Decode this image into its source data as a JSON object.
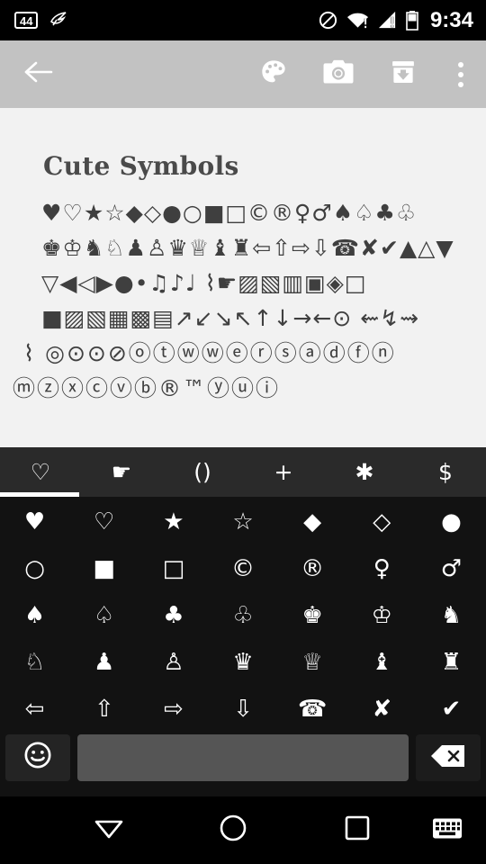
{
  "status_bar": {
    "badge_count": "44",
    "bird_icon": "bird-icon",
    "dnd_icon": "do-not-disturb-icon",
    "wifi_icon": "wifi-warning-icon",
    "cellular_icon": "cellular-warning-icon",
    "battery_icon": "battery-icon",
    "time": "9:34"
  },
  "toolbar": {
    "back_icon": "back-arrow-icon",
    "palette_icon": "palette-icon",
    "camera_icon": "camera-icon",
    "archive_icon": "archive-download-icon",
    "overflow_icon": "overflow-menu-icon"
  },
  "content": {
    "title": "Cute Symbols",
    "symbol_rows": [
      "♥♡★☆◆◇●○■□©®♀♂♠♤♣♧",
      "♚♔♞♘♟♙♛♕♝♜⇦⇧⇨⇩☎✘✔▲△▼",
      "▽◀◁▶●•♫♪♩ ⌇☛▨▧▥▣◈□",
      "■▨▧▦▩▤↗↙↘↖↑↓→←⊙ ⇜↯⇝",
      "⌇ ◎⊙⊙⊘ⓞⓣⓦⓦⓔⓡⓢⓐⓓⓕⓝ",
      "ⓜⓩⓧⓒⓥⓑ®™ⓨⓤⓘ"
    ]
  },
  "keyboard": {
    "tabs": [
      {
        "label": "♡",
        "name": "tab-hearts",
        "selected": true
      },
      {
        "label": "☛",
        "name": "tab-hands",
        "selected": false
      },
      {
        "label": "()",
        "name": "tab-brackets",
        "selected": false
      },
      {
        "label": "+",
        "name": "tab-math",
        "selected": false
      },
      {
        "label": "✱",
        "name": "tab-stars",
        "selected": false
      },
      {
        "label": "$",
        "name": "tab-currency",
        "selected": false
      }
    ],
    "keys": [
      [
        "♥",
        "♡",
        "★",
        "☆",
        "◆",
        "◇",
        "●"
      ],
      [
        "○",
        "■",
        "□",
        "©",
        "®",
        "♀",
        "♂"
      ],
      [
        "♠",
        "♤",
        "♣",
        "♧",
        "♚",
        "♔",
        "♞"
      ],
      [
        "♘",
        "♟",
        "♙",
        "♛",
        "♕",
        "♝",
        "♜"
      ],
      [
        "⇦",
        "⇧",
        "⇨",
        "⇩",
        "☎",
        "✘",
        "✔"
      ]
    ],
    "emoji_key_label": "☺",
    "space_key_label": "",
    "delete_icon": "backspace-icon"
  },
  "nav_bar": {
    "back_icon": "collapse-keyboard-icon",
    "home_icon": "home-circle-icon",
    "recents_icon": "recents-square-icon",
    "keyboard_switch_icon": "keyboard-switch-icon"
  }
}
